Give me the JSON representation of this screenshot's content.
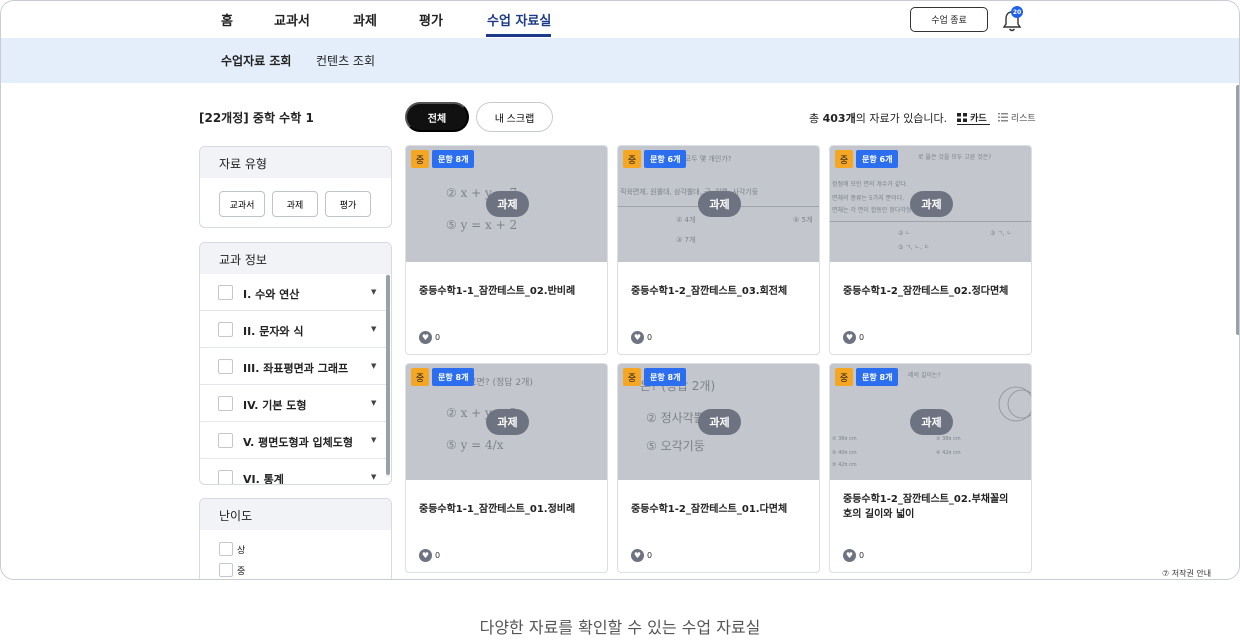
{
  "nav": {
    "items": [
      "홈",
      "교과서",
      "과제",
      "평가",
      "수업 자료실"
    ],
    "end_class": "수업 종료",
    "notification_count": "20"
  },
  "subnav": {
    "items": [
      "수업자료 조회",
      "컨텐츠 조회"
    ]
  },
  "sidebar": {
    "course": "[22개정] 중학 수학 1",
    "material_type": {
      "title": "자료 유형",
      "options": [
        "교과서",
        "과제",
        "평가"
      ]
    },
    "subject_info": {
      "title": "교과 정보",
      "units": [
        "I. 수와 연산",
        "II. 문자와 식",
        "III. 좌표평면과 그래프",
        "IV. 기본 도형",
        "V. 평면도형과 입체도형",
        "VI. 통계"
      ]
    },
    "difficulty": {
      "title": "난이도",
      "options": [
        "상",
        "중"
      ]
    }
  },
  "toolbar": {
    "tab_all": "전체",
    "tab_scrap": "내 스크랩",
    "total_prefix": "총 ",
    "total_count": "403개",
    "total_suffix": "의 자료가 있습니다.",
    "view_card": "카드",
    "view_list": "리스트"
  },
  "cards": [
    {
      "level": "중",
      "count": "문항 8개",
      "type": "과제",
      "title": "중등수학1-1_잠깐테스트_02.반비례",
      "likes": "0",
      "ghost": [
        "② x + y = 7",
        "⑤ y = x + 2"
      ]
    },
    {
      "level": "중",
      "count": "문항 6개",
      "type": "과제",
      "title": "중등수학1-2_잠깐테스트_03.회전체",
      "likes": "0",
      "ghost": [
        "은 모두 몇 개인가?",
        "직육면체, 원뿔대, 삼각뿔대, 구, 원뿔, 사각기둥",
        "② 4개",
        "⑤ 5개",
        "③ 7개"
      ]
    },
    {
      "level": "중",
      "count": "문항 6개",
      "type": "과제",
      "title": "중등수학1-2_잠깐테스트_02.정다면체",
      "likes": "0",
      "ghost": [
        "로 옳은 것을 모두 고른 것은?",
        "정점에 모인 면의 개수가 같다.",
        "면체의 종류는 5가지 뿐이다.",
        "면체는 각 면이 합동인 정다각형이다.",
        "② ㄴ",
        "③ ㄱ, ㄴ",
        "⑤ ㄱ, ㄴ, ㄷ"
      ]
    },
    {
      "level": "중",
      "count": "문항 8개",
      "type": "과제",
      "title": "중등수학1-1_잠깐테스트_01.정비례",
      "likes": "0",
      "ghost": [
        "고르면? (정답 2개)",
        "② x + y = 2",
        "⑤ y = 4/x"
      ]
    },
    {
      "level": "중",
      "count": "문항 8개",
      "type": "과제",
      "title": "중등수학1-2_잠깐테스트_01.다면체",
      "likes": "0",
      "ghost": [
        "은? (정답 2개)",
        "② 정사각뿔",
        "⑤ 오각기둥"
      ]
    },
    {
      "level": "중",
      "count": "문항 8개",
      "type": "과제",
      "title": "중등수학1-2_잠깐테스트_02.부채꼴의 호의 길이와 넓이",
      "likes": "0",
      "ghost": [
        "레의 길이는?",
        "② 36π cm",
        "③ 38π cm",
        "⑤ 40π cm",
        "④ 42π cm",
        "⑤ 42π cm"
      ]
    }
  ],
  "footer": {
    "copyright": "⑦ 저작권 안내",
    "caption": "다양한 자료를 확인할 수 있는 수업 자료실"
  },
  "colors": {
    "accent": "#1d3a8a",
    "subnav_bg": "#e4eefb",
    "badge_blue": "#2b6ff0",
    "badge_orange": "#f5a623"
  }
}
